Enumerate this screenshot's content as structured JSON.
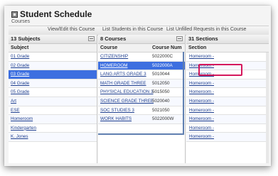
{
  "header": {
    "title": "Student Schedule",
    "subtitle": "Courses"
  },
  "actions": [
    "View/Edit this Course",
    "List Students in this Course",
    "List Unfilled Requests in this Course"
  ],
  "subjects": {
    "title": "13 Subjects",
    "column": "Subject",
    "items": [
      "01 Grade",
      "02 Grade",
      "03 Grade",
      "04 Grade",
      "05 Grade",
      "Art",
      "ESE",
      "Homeroom",
      "Kindergarten",
      "K. Jones"
    ],
    "selected_index": 2
  },
  "courses": {
    "title": "8 Courses",
    "columns": [
      "Course",
      "Course Num"
    ],
    "items": [
      {
        "name": "CITIZENSHIP",
        "num": "5022000C"
      },
      {
        "name": "HOMEROOM",
        "num": "5022000A"
      },
      {
        "name": "LANG ARTS GRADE 3",
        "num": "5010044"
      },
      {
        "name": "MATH GRADE THREE",
        "num": "5012050"
      },
      {
        "name": "PHYSICAL EDUCATION 3",
        "num": "5015050"
      },
      {
        "name": "SCIENCE GRADE THREE",
        "num": "5020040"
      },
      {
        "name": "SOC STUDIES 3",
        "num": "5021050"
      },
      {
        "name": "WORK HABITS",
        "num": "5022000W"
      }
    ],
    "selected_index": 1
  },
  "sections": {
    "title": "31 Sections",
    "column": "Section",
    "items": [
      "Homeroom -",
      "Homeroom -",
      "Homeroom -",
      "Homeroom -",
      "Homeroom -",
      "Homeroom -",
      "Homeroom -",
      "Homeroom -",
      "Homeroom -",
      "Homeroom -"
    ]
  },
  "colors": {
    "selection": "#3d6fe0",
    "highlight": "#d5185c"
  }
}
